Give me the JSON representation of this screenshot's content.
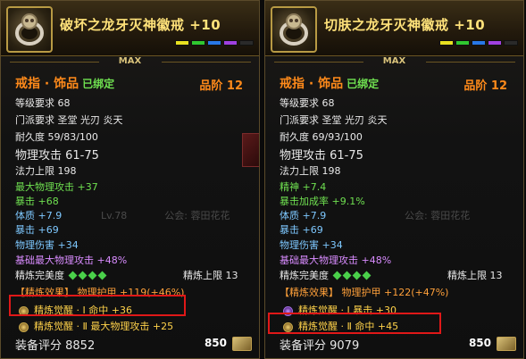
{
  "max_label": "MAX",
  "footer_badge": "850",
  "ghost": {
    "level": "Lv.78",
    "guild": "公会: 蓉田花花"
  },
  "left": {
    "title": "破坏之龙牙灭神徽戒 +10",
    "type": "戒指 · 饰品",
    "bound": "已绑定",
    "grade": "品阶  12",
    "level_req": "等级要求  68",
    "class_req": "门派要求  圣堂 光刃 炎天",
    "durability": "耐久度  59/83/100",
    "phys_atk": "物理攻击  61-75",
    "mana": "法力上限  198",
    "stats": [
      {
        "text": "最大物理攻击 +37",
        "color": "green"
      },
      {
        "text": "暴击 +68",
        "color": "green"
      },
      {
        "text": "体质 +7.9",
        "color": "blue"
      },
      {
        "text": "暴击 +69",
        "color": "blue"
      },
      {
        "text": "物理伤害 +34",
        "color": "blue"
      },
      {
        "text": "基础最大物理攻击 +48%",
        "color": "purple"
      }
    ],
    "refine_label": "精炼完美度",
    "refine_limit": "精炼上限 13",
    "refine_effect": "【精炼效果】 物理护甲 +119(+46%)",
    "awake1": "精炼觉醒 · Ⅰ  命中  +36",
    "awake2": "精炼觉醒 · Ⅱ  最大物理攻击  +25",
    "score": "装备评分 8852"
  },
  "right": {
    "title": "切肤之龙牙灭神徽戒 +10",
    "type": "戒指 · 饰品",
    "bound": "已绑定",
    "grade": "品阶  12",
    "level_req": "等级要求  68",
    "class_req": "门派要求  圣堂 光刃 炎天",
    "durability": "耐久度  69/93/100",
    "phys_atk": "物理攻击  61-75",
    "mana": "法力上限  198",
    "stats": [
      {
        "text": "精神 +7.4",
        "color": "green"
      },
      {
        "text": "暴击加成率 +9.1%",
        "color": "green"
      },
      {
        "text": "体质 +7.9",
        "color": "blue"
      },
      {
        "text": "暴击 +69",
        "color": "blue"
      },
      {
        "text": "物理伤害 +34",
        "color": "blue"
      },
      {
        "text": "基础最大物理攻击 +48%",
        "color": "purple"
      }
    ],
    "refine_label": "精炼完美度",
    "refine_limit": "精炼上限 13",
    "refine_effect": "【精炼效果】 物理护甲 +122(+47%)",
    "awake1": "精炼觉醒 · Ⅰ  暴击  +30",
    "awake2": "精炼觉醒 · Ⅱ  命中  +45",
    "score": "装备评分 9079"
  }
}
